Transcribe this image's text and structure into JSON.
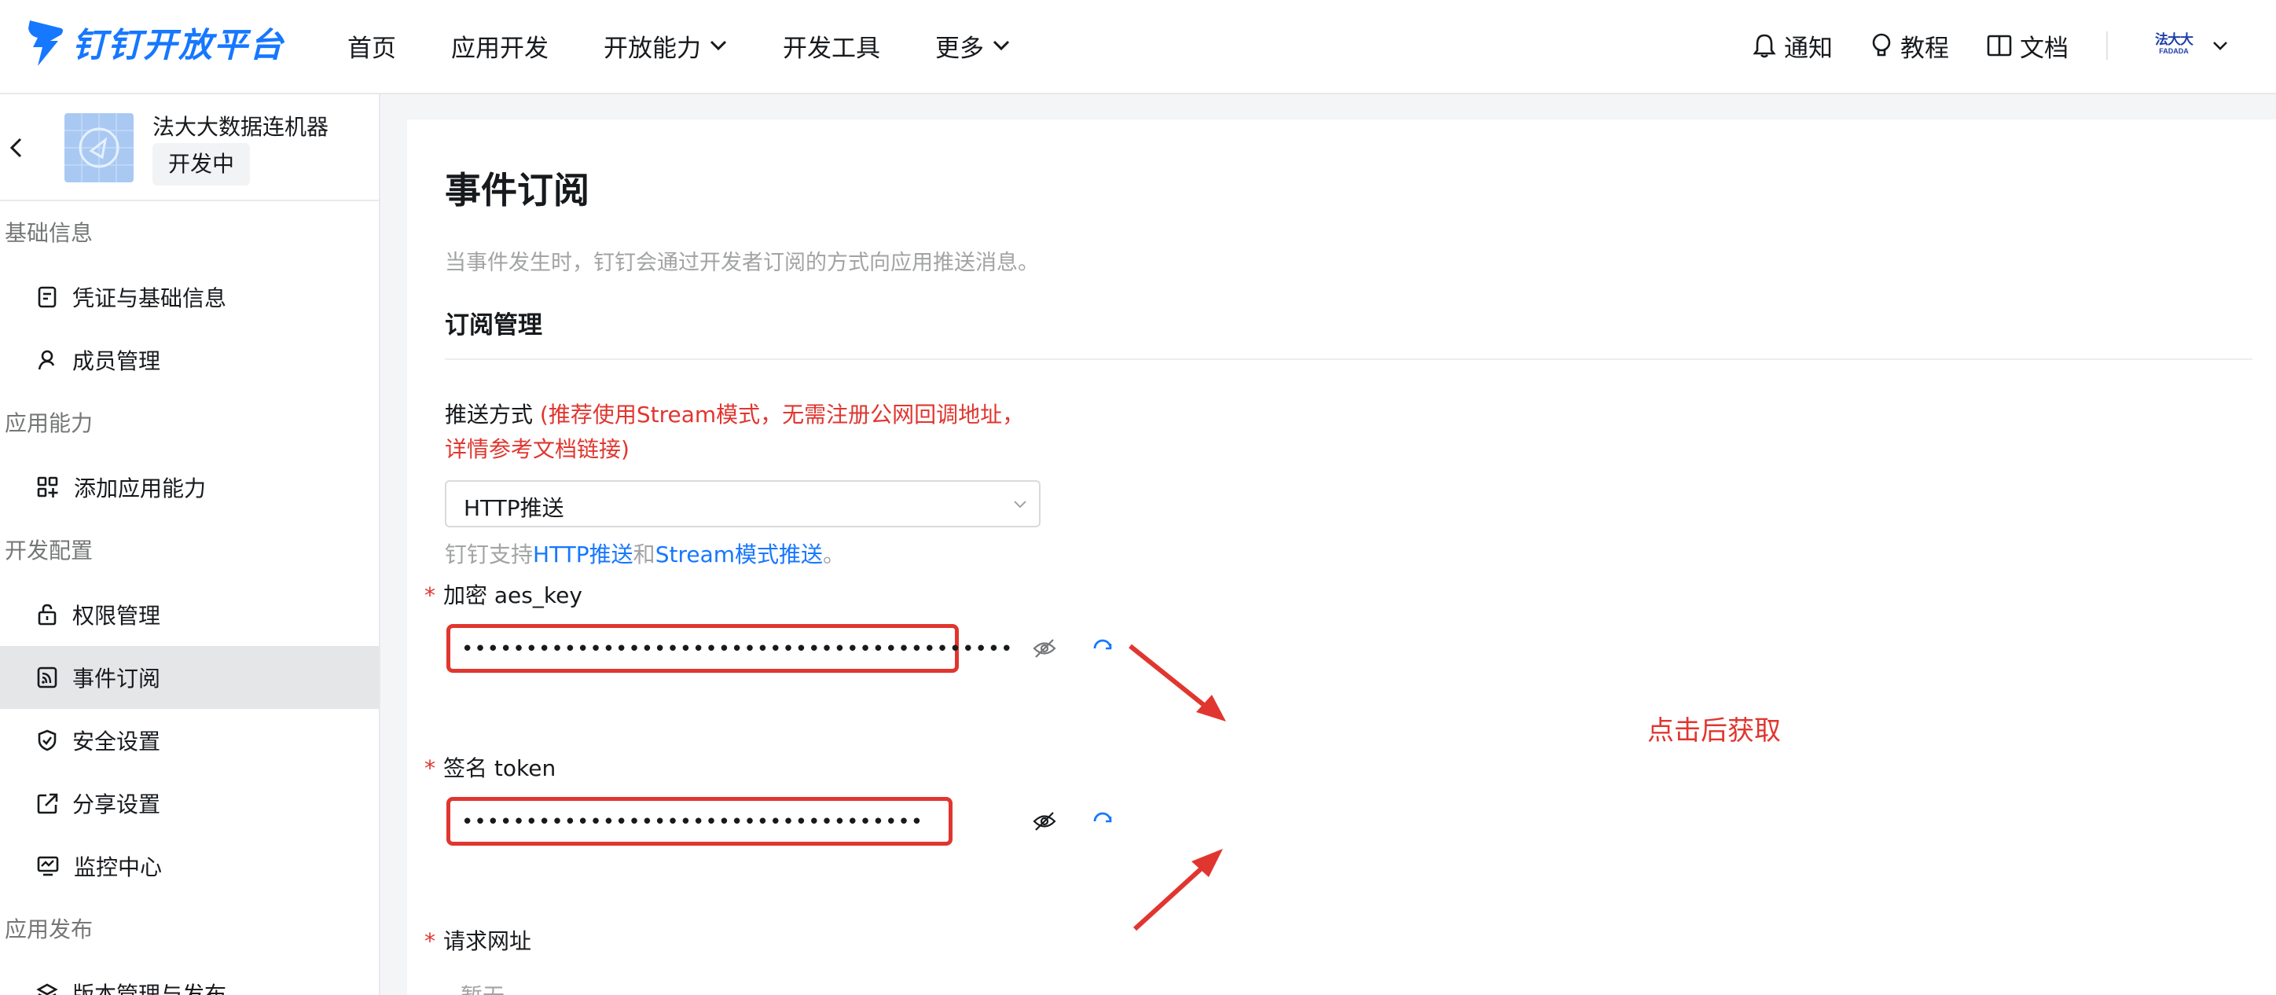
{
  "brand": {
    "name": "钉钉开放平台",
    "accent": "#1677ff"
  },
  "nav": {
    "items": [
      {
        "label": "首页",
        "dropdown": false
      },
      {
        "label": "应用开发",
        "dropdown": false
      },
      {
        "label": "开放能力",
        "dropdown": true
      },
      {
        "label": "开发工具",
        "dropdown": false
      },
      {
        "label": "更多",
        "dropdown": true
      }
    ],
    "right": [
      {
        "label": "通知",
        "icon": "bell-icon"
      },
      {
        "label": "教程",
        "icon": "lightbulb-icon"
      },
      {
        "label": "文档",
        "icon": "book-icon"
      }
    ],
    "user_logo": "法大大",
    "user_logo_sub": "FADADA"
  },
  "app": {
    "name": "法大大数据连机器",
    "status": "开发中"
  },
  "sidebar": {
    "groups": [
      {
        "title": "基础信息",
        "items": [
          {
            "label": "凭证与基础信息",
            "icon": "credential-icon"
          },
          {
            "label": "成员管理",
            "icon": "member-icon"
          }
        ]
      },
      {
        "title": "应用能力",
        "items": [
          {
            "label": "添加应用能力",
            "icon": "add-capability-icon"
          }
        ]
      },
      {
        "title": "开发配置",
        "items": [
          {
            "label": "权限管理",
            "icon": "lock-icon"
          },
          {
            "label": "事件订阅",
            "icon": "subscription-icon",
            "active": true
          },
          {
            "label": "安全设置",
            "icon": "shield-icon"
          },
          {
            "label": "分享设置",
            "icon": "share-icon"
          },
          {
            "label": "监控中心",
            "icon": "monitor-icon"
          }
        ]
      },
      {
        "title": "应用发布",
        "items": [
          {
            "label": "版本管理与发布",
            "icon": "version-icon"
          }
        ]
      }
    ]
  },
  "page": {
    "title": "事件订阅",
    "description": "当事件发生时，钉钉会通过开发者订阅的方式向应用推送消息。",
    "section": "订阅管理"
  },
  "form": {
    "push_mode": {
      "label": "推送方式",
      "hint_prefix": "(推荐使用Stream模式，无需注册公网回调地址，详情",
      "hint_link": "参考文档链接",
      "hint_suffix": ")",
      "value": "HTTP推送",
      "support_prefix": "钉钉支持",
      "support_link1": "HTTP推送",
      "support_and": "和",
      "support_link2": "Stream模式推送",
      "support_suffix": "。"
    },
    "aes_key": {
      "label": "加密 aes_key",
      "required": true,
      "masked_value": "•••••••••••••••••••••••••••••••••••••••••••"
    },
    "token": {
      "label": "签名 token",
      "required": true,
      "masked_value": "••••••••••••••••••••••••••••••••••••"
    },
    "request_url": {
      "label": "请求网址",
      "required": true,
      "value": "暂无"
    }
  },
  "annotation": {
    "text": "点击后获取",
    "color": "#e0362f"
  }
}
